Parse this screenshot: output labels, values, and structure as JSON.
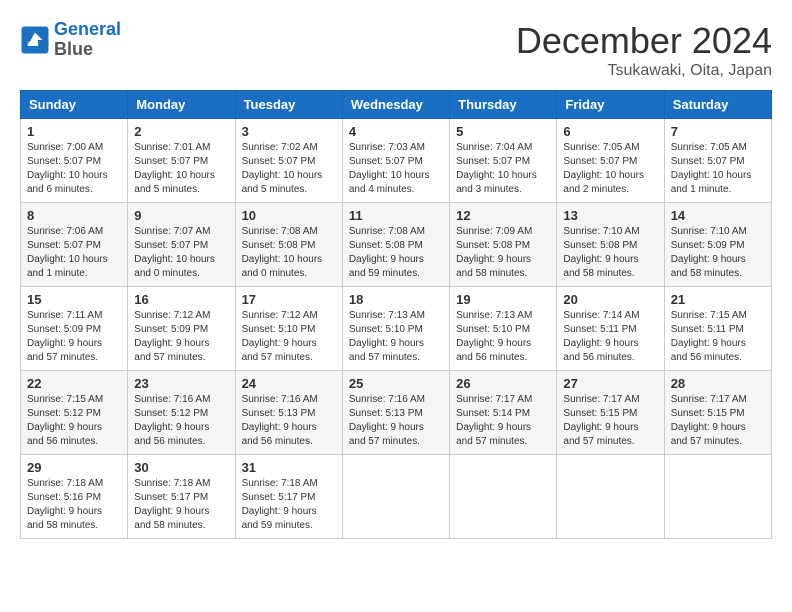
{
  "header": {
    "logo_line1": "General",
    "logo_line2": "Blue",
    "month_title": "December 2024",
    "location": "Tsukawaki, Oita, Japan"
  },
  "weekdays": [
    "Sunday",
    "Monday",
    "Tuesday",
    "Wednesday",
    "Thursday",
    "Friday",
    "Saturday"
  ],
  "weeks": [
    [
      {
        "day": "1",
        "sunrise": "7:00 AM",
        "sunset": "5:07 PM",
        "daylight": "10 hours and 6 minutes."
      },
      {
        "day": "2",
        "sunrise": "7:01 AM",
        "sunset": "5:07 PM",
        "daylight": "10 hours and 5 minutes."
      },
      {
        "day": "3",
        "sunrise": "7:02 AM",
        "sunset": "5:07 PM",
        "daylight": "10 hours and 5 minutes."
      },
      {
        "day": "4",
        "sunrise": "7:03 AM",
        "sunset": "5:07 PM",
        "daylight": "10 hours and 4 minutes."
      },
      {
        "day": "5",
        "sunrise": "7:04 AM",
        "sunset": "5:07 PM",
        "daylight": "10 hours and 3 minutes."
      },
      {
        "day": "6",
        "sunrise": "7:05 AM",
        "sunset": "5:07 PM",
        "daylight": "10 hours and 2 minutes."
      },
      {
        "day": "7",
        "sunrise": "7:05 AM",
        "sunset": "5:07 PM",
        "daylight": "10 hours and 1 minute."
      }
    ],
    [
      {
        "day": "8",
        "sunrise": "7:06 AM",
        "sunset": "5:07 PM",
        "daylight": "10 hours and 1 minute."
      },
      {
        "day": "9",
        "sunrise": "7:07 AM",
        "sunset": "5:07 PM",
        "daylight": "10 hours and 0 minutes."
      },
      {
        "day": "10",
        "sunrise": "7:08 AM",
        "sunset": "5:08 PM",
        "daylight": "10 hours and 0 minutes."
      },
      {
        "day": "11",
        "sunrise": "7:08 AM",
        "sunset": "5:08 PM",
        "daylight": "9 hours and 59 minutes."
      },
      {
        "day": "12",
        "sunrise": "7:09 AM",
        "sunset": "5:08 PM",
        "daylight": "9 hours and 58 minutes."
      },
      {
        "day": "13",
        "sunrise": "7:10 AM",
        "sunset": "5:08 PM",
        "daylight": "9 hours and 58 minutes."
      },
      {
        "day": "14",
        "sunrise": "7:10 AM",
        "sunset": "5:09 PM",
        "daylight": "9 hours and 58 minutes."
      }
    ],
    [
      {
        "day": "15",
        "sunrise": "7:11 AM",
        "sunset": "5:09 PM",
        "daylight": "9 hours and 57 minutes."
      },
      {
        "day": "16",
        "sunrise": "7:12 AM",
        "sunset": "5:09 PM",
        "daylight": "9 hours and 57 minutes."
      },
      {
        "day": "17",
        "sunrise": "7:12 AM",
        "sunset": "5:10 PM",
        "daylight": "9 hours and 57 minutes."
      },
      {
        "day": "18",
        "sunrise": "7:13 AM",
        "sunset": "5:10 PM",
        "daylight": "9 hours and 57 minutes."
      },
      {
        "day": "19",
        "sunrise": "7:13 AM",
        "sunset": "5:10 PM",
        "daylight": "9 hours and 56 minutes."
      },
      {
        "day": "20",
        "sunrise": "7:14 AM",
        "sunset": "5:11 PM",
        "daylight": "9 hours and 56 minutes."
      },
      {
        "day": "21",
        "sunrise": "7:15 AM",
        "sunset": "5:11 PM",
        "daylight": "9 hours and 56 minutes."
      }
    ],
    [
      {
        "day": "22",
        "sunrise": "7:15 AM",
        "sunset": "5:12 PM",
        "daylight": "9 hours and 56 minutes."
      },
      {
        "day": "23",
        "sunrise": "7:16 AM",
        "sunset": "5:12 PM",
        "daylight": "9 hours and 56 minutes."
      },
      {
        "day": "24",
        "sunrise": "7:16 AM",
        "sunset": "5:13 PM",
        "daylight": "9 hours and 56 minutes."
      },
      {
        "day": "25",
        "sunrise": "7:16 AM",
        "sunset": "5:13 PM",
        "daylight": "9 hours and 57 minutes."
      },
      {
        "day": "26",
        "sunrise": "7:17 AM",
        "sunset": "5:14 PM",
        "daylight": "9 hours and 57 minutes."
      },
      {
        "day": "27",
        "sunrise": "7:17 AM",
        "sunset": "5:15 PM",
        "daylight": "9 hours and 57 minutes."
      },
      {
        "day": "28",
        "sunrise": "7:17 AM",
        "sunset": "5:15 PM",
        "daylight": "9 hours and 57 minutes."
      }
    ],
    [
      {
        "day": "29",
        "sunrise": "7:18 AM",
        "sunset": "5:16 PM",
        "daylight": "9 hours and 58 minutes."
      },
      {
        "day": "30",
        "sunrise": "7:18 AM",
        "sunset": "5:17 PM",
        "daylight": "9 hours and 58 minutes."
      },
      {
        "day": "31",
        "sunrise": "7:18 AM",
        "sunset": "5:17 PM",
        "daylight": "9 hours and 59 minutes."
      },
      null,
      null,
      null,
      null
    ]
  ]
}
